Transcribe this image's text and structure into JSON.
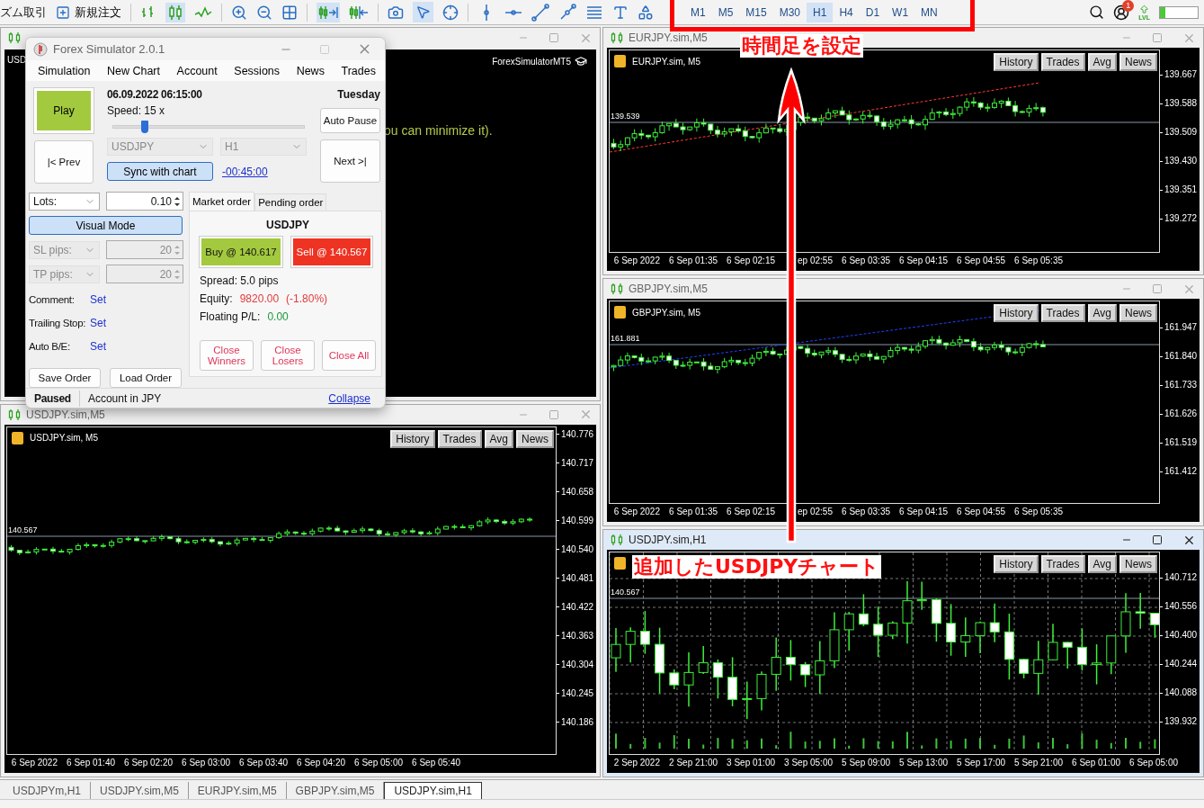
{
  "toolbar": {
    "algo_trading": "ズム取引",
    "new_order": "新規注文",
    "timeframes": [
      {
        "label": "M1",
        "selected": false
      },
      {
        "label": "M5",
        "selected": false
      },
      {
        "label": "M15",
        "selected": false
      },
      {
        "label": "M30",
        "selected": false
      },
      {
        "label": "H1",
        "selected": true
      },
      {
        "label": "H4",
        "selected": false
      },
      {
        "label": "D1",
        "selected": false
      },
      {
        "label": "W1",
        "selected": false
      },
      {
        "label": "MN",
        "selected": false
      }
    ],
    "notification_count": "1",
    "level_badge": "LVL"
  },
  "background_chart": {
    "symbol": "USD",
    "brand": "ForexSimulatorMT5",
    "message": "ou can minimize it)."
  },
  "simulator": {
    "title": "Forex Simulator 2.0.1",
    "menu": [
      "Simulation",
      "New Chart",
      "Account",
      "Sessions",
      "News",
      "Trades"
    ],
    "play": "Play",
    "prev": "|<  Prev",
    "next": "Next  >|",
    "datetime": "06.09.2022 06:15:00",
    "weekday": "Tuesday",
    "speed": "Speed: 15 x",
    "speed_slider": {
      "level": 0.17
    },
    "auto_pause": "Auto Pause",
    "symbol": {
      "value": "USDJPY",
      "disabled": true
    },
    "timeframe": {
      "value": "H1",
      "disabled": true
    },
    "sync": "Sync with chart",
    "offset": "-00:45:00",
    "amount_rows": [
      {
        "label": "Lots:",
        "value": "0.10",
        "disabled": false
      },
      {
        "label": "SL pips:",
        "value": "20",
        "disabled": true
      },
      {
        "label": "TP pips:",
        "value": "20",
        "disabled": true
      }
    ],
    "visual_mode": "Visual Mode",
    "settings": [
      {
        "label": "Comment:",
        "link": "Set"
      },
      {
        "label": "Trailing Stop:",
        "link": "Set"
      },
      {
        "label": "Auto B/E:",
        "link": "Set"
      }
    ],
    "save": "Save Order",
    "load": "Load Order",
    "order_tabs": [
      {
        "label": "Market order",
        "selected": true
      },
      {
        "label": "Pending order",
        "selected": false
      }
    ],
    "symbol_title": "USDJPY",
    "buy": "Buy @ 140.617",
    "sell": "Sell @ 140.567",
    "spread": "Spread: 5.0 pips",
    "equity": {
      "label": "Equity:",
      "value": "9820.00",
      "change": "(-1.80%)"
    },
    "floating": {
      "label": "Floating P/L:",
      "value": "0.00"
    },
    "close_buttons": [
      "Close Winners",
      "Close Losers",
      "Close All"
    ],
    "status": "Paused",
    "account": "Account in JPY",
    "collapse": "Collapse"
  },
  "charts": [
    {
      "title": "USDJPY.sim,M5",
      "label": "USDJPY.sim, M5",
      "active": false,
      "kind": "m5",
      "current_price": "140.567",
      "buttons": [
        "History",
        "Trades",
        "Avg",
        "News"
      ],
      "price_labels": [
        "140.776",
        "140.717",
        "140.658",
        "140.599",
        "140.540",
        "140.481",
        "140.422",
        "140.363",
        "140.304",
        "140.245",
        "140.186"
      ],
      "time_labels": [
        "6 Sep 2022",
        "6 Sep 01:40",
        "6 Sep 02:20",
        "6 Sep 03:00",
        "6 Sep 03:40",
        "6 Sep 04:20",
        "6 Sep 05:00",
        "6 Sep 05:40"
      ]
    },
    {
      "title": "EURJPY.sim,M5",
      "label": "EURJPY.sim, M5",
      "active": false,
      "kind": "m5",
      "trendline": {
        "color": "#ff3b30"
      },
      "current_price": "139.539",
      "buttons": [
        "History",
        "Trades",
        "Avg",
        "News"
      ],
      "price_labels": [
        "139.667",
        "139.588",
        "139.509",
        "139.430",
        "139.351",
        "139.272"
      ],
      "time_labels": [
        "6 Sep 2022",
        "6 Sep 01:35",
        "6 Sep 02:15",
        "ep 02:55",
        "6 Sep 03:35",
        "6 Sep 04:15",
        "6 Sep 04:55",
        "6 Sep 05:35"
      ]
    },
    {
      "title": "GBPJPY.sim,M5",
      "label": "GBPJPY.sim, M5",
      "active": false,
      "kind": "m5",
      "trendline": {
        "color": "#2040ff"
      },
      "current_price": "161.881",
      "buttons": [
        "History",
        "Trades",
        "Avg",
        "News"
      ],
      "price_labels": [
        "161.947",
        "161.840",
        "161.733",
        "161.626",
        "161.519",
        "161.412"
      ],
      "time_labels": [
        "6 Sep 2022",
        "6 Sep 01:35",
        "6 Sep 02:15",
        "ep 02:55",
        "6 Sep 03:35",
        "6 Sep 04:15",
        "6 Sep 04:55",
        "6 Sep 05:35"
      ]
    },
    {
      "title": "USDJPY.sim,H1",
      "active": true,
      "kind": "h1",
      "current_price": "140.567",
      "buttons": [
        "History",
        "Trades",
        "Avg",
        "News"
      ],
      "price_labels": [
        "140.712",
        "140.556",
        "140.400",
        "140.244",
        "140.088",
        "139.932"
      ],
      "time_labels": [
        "2 Sep 2022",
        "2 Sep 21:00",
        "3 Sep 01:00",
        "3 Sep 05:00",
        "5 Sep 09:00",
        "5 Sep 13:00",
        "5 Sep 17:00",
        "5 Sep 21:00",
        "6 Sep 01:00",
        "6 Sep 05:00"
      ]
    }
  ],
  "tabs": [
    {
      "label": "USDJPYm,H1",
      "selected": false
    },
    {
      "label": "USDJPY.sim,M5",
      "selected": false
    },
    {
      "label": "EURJPY.sim,M5",
      "selected": false
    },
    {
      "label": "GBPJPY.sim,M5",
      "selected": false
    },
    {
      "label": "USDJPY.sim,H1",
      "selected": true
    }
  ],
  "annotations": {
    "timeframe_note": "時間足を設定",
    "chart_note": "追加したUSDJPYチャート"
  }
}
